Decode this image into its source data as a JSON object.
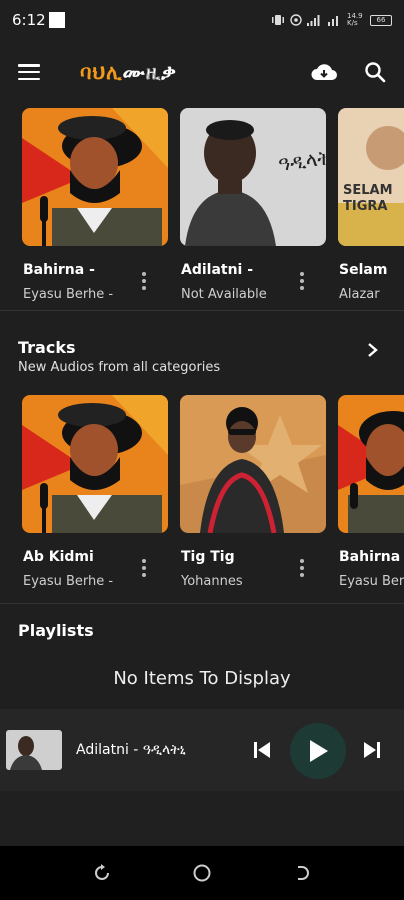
{
  "status": {
    "time": "6:12",
    "net_speed": "14.9 K/s",
    "battery": "66"
  },
  "app": {
    "brand_part1": "ባህሊ",
    "brand_part2": "ሙዚቃ"
  },
  "row1": [
    {
      "title": "Bahirna -",
      "artist": "Eyasu Berhe -"
    },
    {
      "title": "Adilatni -",
      "artist": "Not Available",
      "cover_text": "ዓዲላትነ"
    },
    {
      "title": "Selam",
      "artist": "Alazar",
      "cover_text": "SELAM\nTIGRA"
    }
  ],
  "tracks": {
    "heading": "Tracks",
    "subtitle": "New Audios from all categories",
    "items": [
      {
        "title": "Ab Kidmi",
        "artist": "Eyasu Berhe -"
      },
      {
        "title": "Tig Tig",
        "artist": "Yohannes"
      },
      {
        "title": "Bahirna -",
        "artist": "Eyasu Berh"
      }
    ]
  },
  "playlists": {
    "heading": "Playlists",
    "empty": "No Items To Display"
  },
  "player": {
    "now_playing": "Adilatni - ዓዲላትኒ"
  },
  "colors": {
    "accent": "#f29a1b",
    "background": "#1f1f1f",
    "play_button": "#1e3a34"
  }
}
